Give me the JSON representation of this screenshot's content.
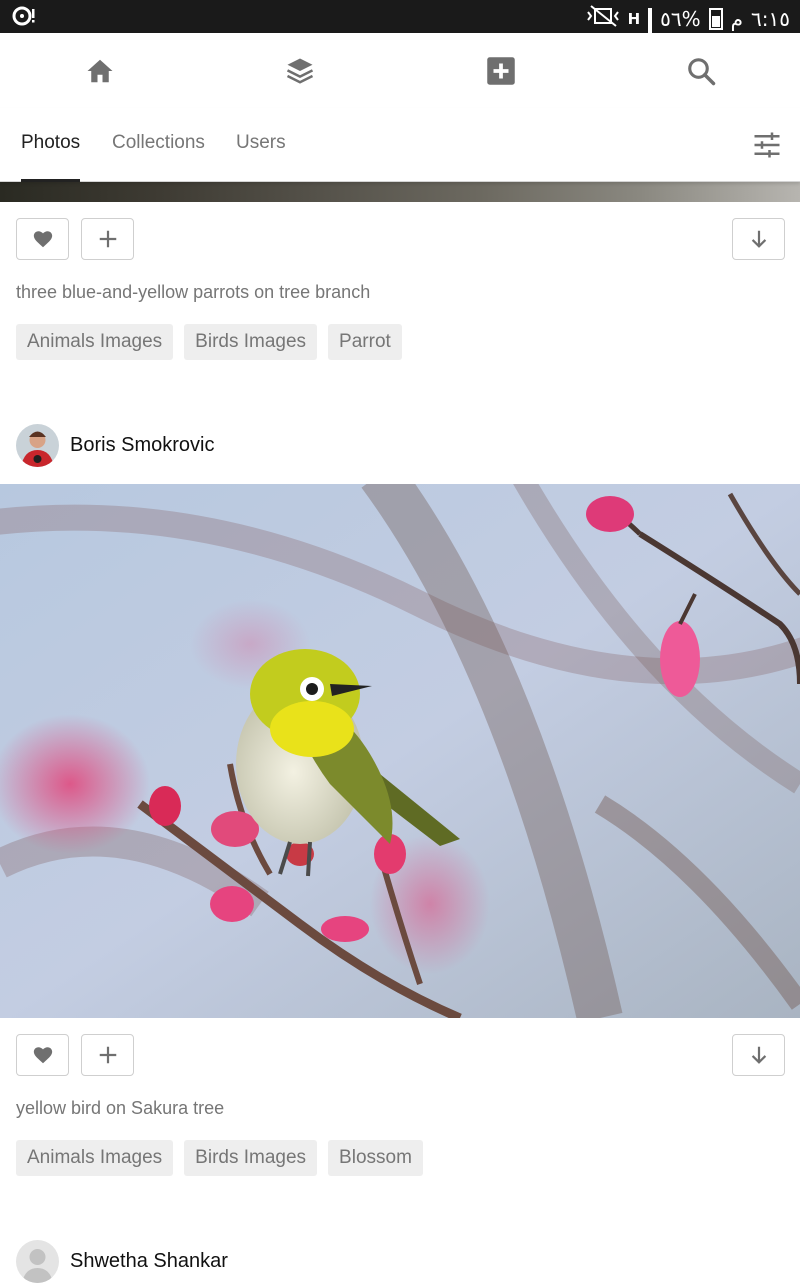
{
  "status_bar": {
    "time": "٦:١٥",
    "am_pm": "م",
    "battery": "٥٦%",
    "network": "H"
  },
  "top_nav": {
    "items": [
      "home-icon",
      "collections-icon",
      "add-photo-icon",
      "search-icon"
    ]
  },
  "tabs": {
    "items": [
      {
        "label": "Photos",
        "active": true
      },
      {
        "label": "Collections",
        "active": false
      },
      {
        "label": "Users",
        "active": false
      }
    ]
  },
  "posts": [
    {
      "caption": "three blue-and-yellow parrots on tree branch",
      "tags": [
        "Animals Images",
        "Birds Images",
        "Parrot"
      ]
    },
    {
      "author": "Boris Smokrovic",
      "caption": "yellow bird on Sakura tree",
      "tags": [
        "Animals Images",
        "Birds Images",
        "Blossom"
      ]
    },
    {
      "author": "Shwetha Shankar"
    }
  ],
  "colors": {
    "status_bar_bg": "#1a1a1a",
    "icon_gray": "#707070",
    "tag_bg": "#eeeeee",
    "text_muted": "#767676"
  }
}
